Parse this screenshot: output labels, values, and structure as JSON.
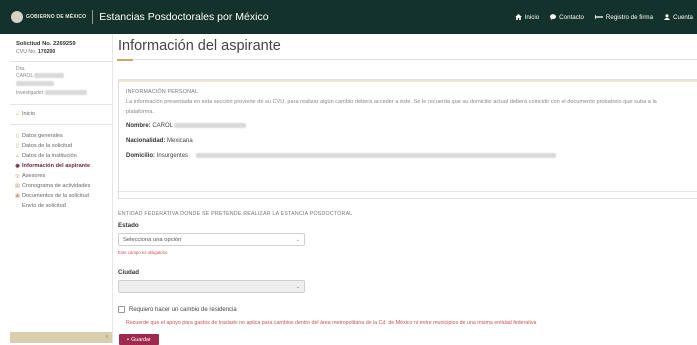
{
  "navbar": {
    "logo_text": "GOBIERNO DE MÉXICO",
    "brand_title": "Estancias Posdoctorales por México",
    "links": [
      {
        "label": "Inicio",
        "icon": "home-icon"
      },
      {
        "label": "Contacto",
        "icon": "chat-icon"
      },
      {
        "label": "Registro de firma",
        "icon": "pen-icon"
      },
      {
        "label": "Cuenta",
        "icon": "user-icon"
      }
    ],
    "colors": {
      "background": "#13322b",
      "text": "#ffffff"
    }
  },
  "sidebar": {
    "request_title": "Solicitud No. 2269259",
    "cvu_label": "CVU No.",
    "cvu_value": "170200",
    "name_label": "Dra.",
    "name_value": "CAROL",
    "researcher_label": "Investigador",
    "menu_top": {
      "label": "Inicio",
      "icon": "home-icon"
    },
    "menu": [
      {
        "label": "Datos generales",
        "icon": "document-icon",
        "active": false
      },
      {
        "label": "Datos de la solicitud",
        "icon": "document-icon",
        "active": false
      },
      {
        "label": "Datos de la institución",
        "icon": "building-icon",
        "active": false
      },
      {
        "label": "Información del aspirante",
        "icon": "info-icon",
        "active": true
      },
      {
        "label": "Asesores",
        "icon": "users-icon",
        "active": false
      },
      {
        "label": "Cronograma de actividades",
        "icon": "calendar-icon",
        "active": false
      },
      {
        "label": "Documentos de la solicitud",
        "icon": "folder-icon",
        "active": false
      },
      {
        "label": "Envío de solicitud",
        "icon": "send-icon",
        "active": false
      }
    ],
    "accent_color": "#6d1f3c"
  },
  "main": {
    "page_title": "Información del aspirante",
    "personal": {
      "section_label": "INFORMACIÓN PERSONAL",
      "info_text": "La información presentada en esta sección proviene de su CVU, para realizar algún cambio deberá acceder a éste. Se le recuerda que su domicilio actual deberá coincidir con el documento probatorio que suba a la plataforma.",
      "name_label": "Nombre:",
      "name_value": "CAROL",
      "nationality_label": "Nacionalidad:",
      "nationality_value": "Mexicana",
      "address_label": "Domicilio:",
      "address_value": "Insurgentes"
    },
    "federal": {
      "section_label": "ENTIDAD FEDERATIVA DONDE SE PRETENDE REALIZAR LA ESTANCIA POSDOCTORAL",
      "state_label": "Estado",
      "state_selected": "Selecciona una opción",
      "state_error": "Este campo es obligatorio",
      "city_label": "Ciudad",
      "city_selected": "",
      "residence_checkbox_label": "Requiero hacer un cambio de residencia",
      "residence_note": "Recuerde que el apoyo para gastos de traslado no aplica para cambios dentro del área metropolitana de la Cd. de México ni entre municipios de una misma entidad federativa",
      "save_label": "Guardar"
    },
    "colors": {
      "button": "#9e2b4d",
      "error": "#c94f4f",
      "accent": "#c4a962"
    }
  }
}
